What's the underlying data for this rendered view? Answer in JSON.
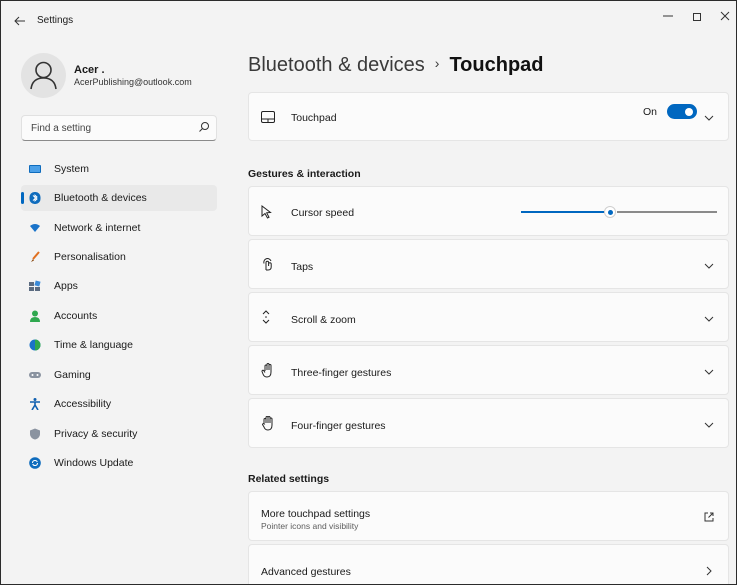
{
  "window": {
    "title": "Settings",
    "back_icon": "back-arrow-icon",
    "controls": [
      "minimize",
      "maximize",
      "close"
    ]
  },
  "profile": {
    "name": "Acer .",
    "email": "AcerPublishing@outlook.com"
  },
  "search": {
    "placeholder": "Find a setting",
    "value": ""
  },
  "sidebar": {
    "items": [
      {
        "label": "System",
        "icon": "system-icon",
        "active": false
      },
      {
        "label": "Bluetooth & devices",
        "icon": "bluetooth-icon",
        "active": true
      },
      {
        "label": "Network & internet",
        "icon": "network-icon",
        "active": false
      },
      {
        "label": "Personalisation",
        "icon": "brush-icon",
        "active": false
      },
      {
        "label": "Apps",
        "icon": "apps-icon",
        "active": false
      },
      {
        "label": "Accounts",
        "icon": "accounts-icon",
        "active": false
      },
      {
        "label": "Time & language",
        "icon": "time-language-icon",
        "active": false
      },
      {
        "label": "Gaming",
        "icon": "gaming-icon",
        "active": false
      },
      {
        "label": "Accessibility",
        "icon": "accessibility-icon",
        "active": false
      },
      {
        "label": "Privacy & security",
        "icon": "shield-icon",
        "active": false
      },
      {
        "label": "Windows Update",
        "icon": "update-icon",
        "active": false
      }
    ]
  },
  "breadcrumb": {
    "parent": "Bluetooth & devices",
    "separator": "›",
    "current": "Touchpad"
  },
  "touchpad_card": {
    "label": "Touchpad",
    "toggle_text": "On",
    "toggle_on": true
  },
  "gestures": {
    "section_title": "Gestures & interaction",
    "cursor_speed": {
      "label": "Cursor speed",
      "value_fraction": 0.5
    },
    "items": [
      {
        "label": "Taps",
        "icon": "tap-icon"
      },
      {
        "label": "Scroll & zoom",
        "icon": "scroll-icon"
      },
      {
        "label": "Three-finger gestures",
        "icon": "hand-icon"
      },
      {
        "label": "Four-finger gestures",
        "icon": "hand-icon"
      }
    ]
  },
  "related": {
    "section_title": "Related settings",
    "more_touchpad": {
      "label": "More touchpad settings",
      "sub": "Pointer icons and visibility"
    },
    "advanced": {
      "label": "Advanced gestures"
    }
  },
  "colors": {
    "accent": "#0067c0",
    "background": "#f3f3f3",
    "card": "#fbfbfb"
  }
}
